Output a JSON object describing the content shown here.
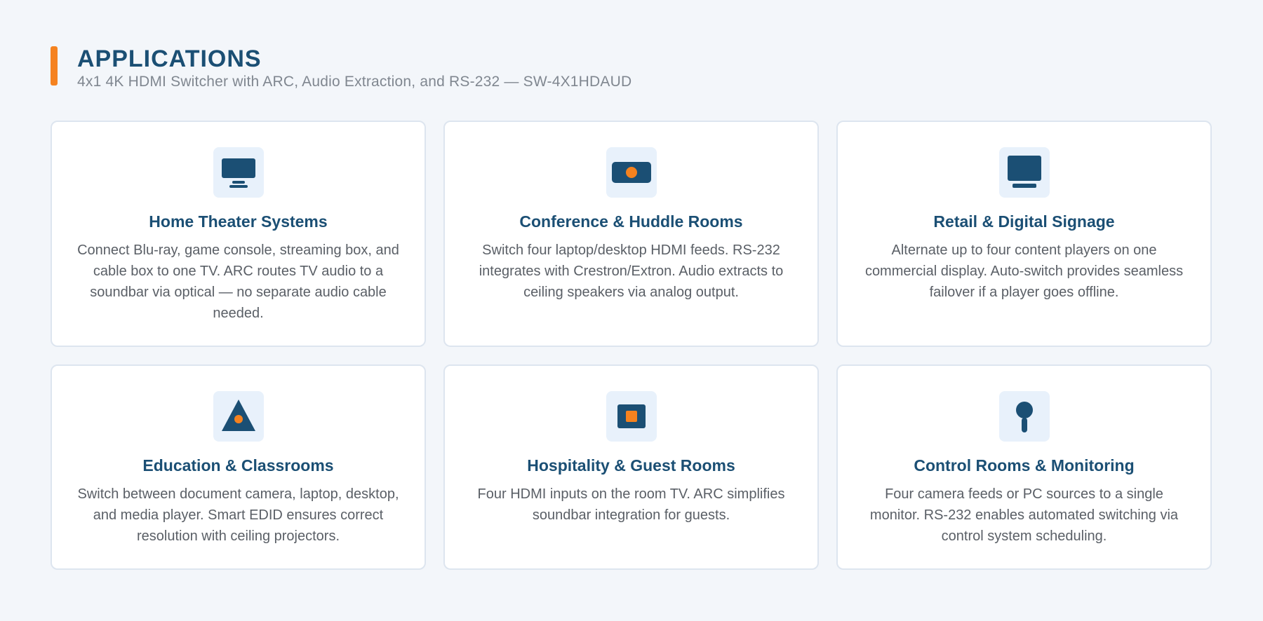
{
  "header": {
    "title": "APPLICATIONS",
    "subtitle": "4x1 4K HDMI Switcher with ARC, Audio Extraction, and RS-232 — SW-4X1HDAUD"
  },
  "colors": {
    "accent": "#f5821f",
    "brand": "#1b4f74",
    "icon_tile_bg": "#e8f1fb"
  },
  "applications": [
    {
      "icon": "monitor-icon",
      "title": "Home Theater Systems",
      "description": "Connect Blu-ray, game console, streaming box, and cable box to one TV. ARC routes TV audio to a soundbar via optical — no separate audio cable needed."
    },
    {
      "icon": "projector-icon",
      "title": "Conference & Huddle Rooms",
      "description": "Switch four laptop/desktop HDMI feeds. RS-232 integrates with Crestron/Extron. Audio extracts to ceiling speakers via analog output."
    },
    {
      "icon": "display-icon",
      "title": "Retail & Digital Signage",
      "description": "Alternate up to four content players on one commercial display. Auto-switch provides seamless failover if a player goes offline."
    },
    {
      "icon": "triangle-icon",
      "title": "Education & Classrooms",
      "description": "Switch between document camera, laptop, desktop, and media player. Smart EDID ensures correct resolution with ceiling projectors."
    },
    {
      "icon": "tv-box-icon",
      "title": "Hospitality & Guest Rooms",
      "description": "Four HDMI inputs on the room TV. ARC simplifies soundbar integration for guests."
    },
    {
      "icon": "camera-pin-icon",
      "title": "Control Rooms & Monitoring",
      "description": "Four camera feeds or PC sources to a single monitor. RS-232 enables automated switching via control system scheduling."
    }
  ]
}
